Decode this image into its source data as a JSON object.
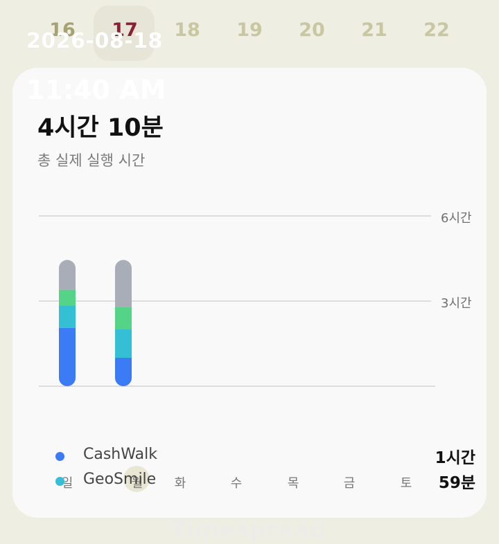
{
  "header": {
    "dates": [
      "16",
      "17",
      "18",
      "19",
      "20",
      "21",
      "22"
    ],
    "selected_date": "17",
    "overlay_date": "2026-08-18",
    "overlay_time": "11:40 AM"
  },
  "summary": {
    "total": "4시간 10분",
    "subtitle": "총 실제 실행 시간"
  },
  "chart_data": {
    "type": "bar",
    "categories": [
      "일",
      "월",
      "화",
      "수",
      "목",
      "금",
      "토"
    ],
    "y_ticks": [
      "6시간",
      "3시간"
    ],
    "ylim": [
      0,
      6
    ],
    "series": [
      {
        "name": "CashWalk",
        "color": "#3b7cf6",
        "values": [
          2.05,
          1.0,
          0,
          0,
          0,
          0,
          0
        ]
      },
      {
        "name": "GeoSmile",
        "color": "#35bfd5",
        "values": [
          0.8,
          1.0,
          0,
          0,
          0,
          0,
          0
        ]
      },
      {
        "name": "",
        "color": "#55d487",
        "values": [
          0.55,
          0.8,
          0,
          0,
          0,
          0,
          0
        ]
      },
      {
        "name": "",
        "color": "#a8adb8",
        "values": [
          1.05,
          1.65,
          0,
          0,
          0,
          0,
          0
        ]
      }
    ]
  },
  "legend": [
    {
      "name": "CashWalk",
      "time": "1시간",
      "color": "#3b7cf6"
    },
    {
      "name": "GeoSmile",
      "time": "59분",
      "color": "#35bfd5"
    }
  ],
  "watermark": "Timespread"
}
